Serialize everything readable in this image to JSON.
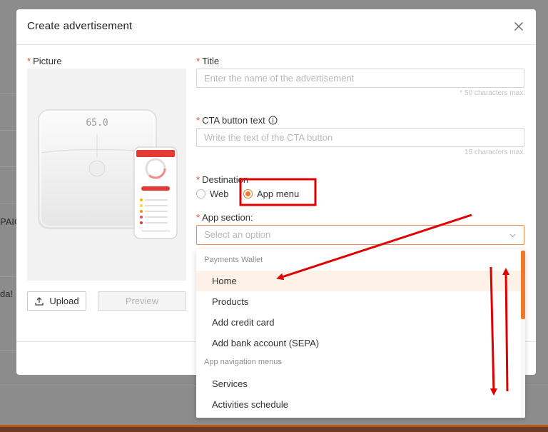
{
  "background": {
    "fragment_1": "PAIG",
    "fragment_2": "da!"
  },
  "modal": {
    "title": "Create advertisement",
    "picture_label": "Picture",
    "upload_label": "Upload",
    "preview_label": "Preview",
    "title_label": "Title",
    "title_placeholder": "Enter the name of the advertisement",
    "title_hint": "* 50 characters max.",
    "cta_label": "CTA button text",
    "cta_placeholder": "Write the text of the CTA button",
    "cta_hint": "15 characters max.",
    "destination_label": "Destination",
    "destination_options": [
      "Web",
      "App menu"
    ],
    "destination_selected": "App menu",
    "app_section_label": "App section:",
    "app_section_placeholder": "Select an option",
    "required_mark": "*"
  },
  "scale_display": "65.0",
  "dropdown": {
    "groups": [
      {
        "label": "Payments Wallet",
        "items": [
          "Home",
          "Products",
          "Add credit card",
          "Add bank account (SEPA)"
        ]
      },
      {
        "label": "App navigation menus",
        "items": [
          "Services",
          "Activities schedule"
        ]
      }
    ],
    "active_item": "Home"
  },
  "colors": {
    "accent": "#ee7a2e",
    "annotation": "#e00000",
    "required": "#e8462e"
  }
}
